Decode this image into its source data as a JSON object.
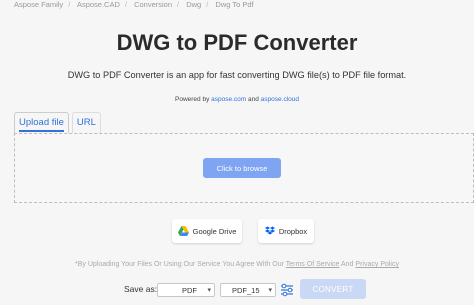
{
  "breadcrumb": [
    "Aspose Family",
    "Aspose.CAD",
    "Conversion",
    "Dwg",
    "Dwg To Pdf"
  ],
  "title": "DWG to PDF Converter",
  "subtitle": "DWG to PDF Converter is an app for fast converting DWG file(s) to PDF file format.",
  "powered": {
    "prefix": "Powered by",
    "link1": "aspose.com",
    "and": "and",
    "link2": "aspose.cloud"
  },
  "tabs": [
    {
      "label": "Upload file",
      "active": true
    },
    {
      "label": "URL",
      "active": false
    }
  ],
  "upload": {
    "browse_label": "Click to browse"
  },
  "cloud": {
    "gdrive_label": "Google Drive",
    "dropbox_label": "Dropbox"
  },
  "terms": {
    "prefix": "*By Uploading Your Files Or Using Our Service You Agree With Our",
    "tos": "Terms Of Service",
    "and": "And",
    "privacy": "Privacy Policy"
  },
  "save": {
    "label": "Save as:",
    "format": "PDF",
    "version": "PDF_15",
    "convert_label": "CONVERT"
  },
  "colors": {
    "accent": "#2f73d8",
    "browse_button": "#7fa4f1",
    "convert_button_disabled": "#c9d8f4"
  },
  "icons": [
    "google-drive-icon",
    "dropbox-icon",
    "settings-sliders-icon",
    "chevron-down-icon"
  ]
}
